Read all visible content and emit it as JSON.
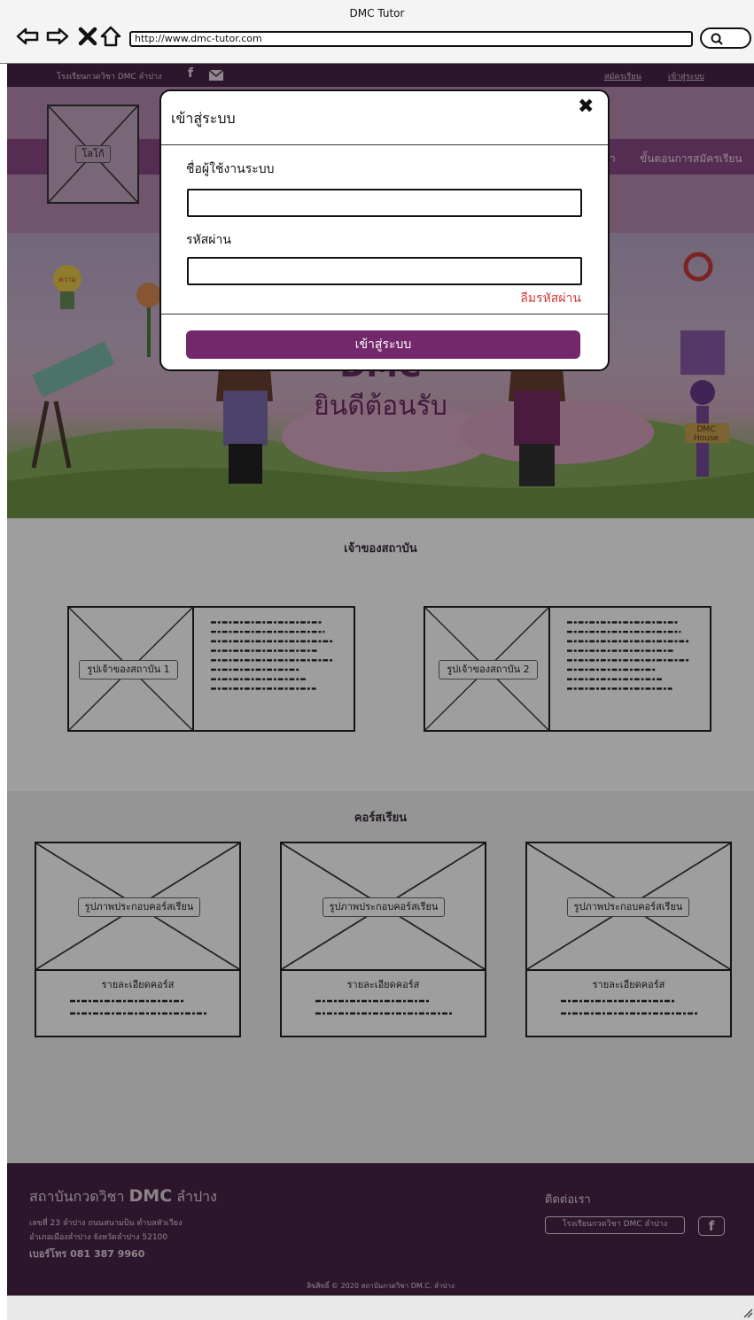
{
  "browser": {
    "window_title": "DMC Tutor",
    "url": "http://www.dmc-tutor.com"
  },
  "topbar": {
    "school_name": "โรงเรียนกวดวิชา DMC ลำปาง",
    "register_link": "สมัครเรียน",
    "login_link": "เข้าสู่ระบบ"
  },
  "header": {
    "logo_label": "โลโก้",
    "menu_partial": "า",
    "menu_register_steps": "ขั้นตอนการสมัครเรียน"
  },
  "banner": {
    "headline": "DMC",
    "welcome": "ยินดีต้อนรับ",
    "sign_text": "DMC House",
    "bulb_text": "ความ"
  },
  "owners": {
    "title": "เจ้าของสถาบัน",
    "items": [
      {
        "image_label": "รูปเจ้าของสถาบัน 1"
      },
      {
        "image_label": "รูปเจ้าของสถาบัน 2"
      }
    ]
  },
  "courses": {
    "title": "คอร์สเรียน",
    "items": [
      {
        "image_label": "รูปภาพประกอบคอร์สเรียน",
        "detail_title": "รายละเอียดคอร์ส"
      },
      {
        "image_label": "รูปภาพประกอบคอร์สเรียน",
        "detail_title": "รายละเอียดคอร์ส"
      },
      {
        "image_label": "รูปภาพประกอบคอร์สเรียน",
        "detail_title": "รายละเอียดคอร์ส"
      }
    ]
  },
  "footer": {
    "institute_prefix": "สถาบันกวดวิชา",
    "institute_brand": "DMC",
    "institute_city": "ลำปาง",
    "address_line1": "เลขที่ 23 ลำปาง ถนนสนามบิน ตำบลหัวเวียง",
    "address_line2": "อำเภอเมืองลำปาง จังหวัดลำปาง 52100",
    "phone_line": "เบอร์โทร 081 387 9960",
    "contact_title": "ติดต่อเรา",
    "facebook_page": "โรงเรียนกวดวิชา DMC ลำปาง",
    "copyright": "ลิขสิทธิ์ © 2020 สถาบันกวดวิชา DM.C. ลำปาง"
  },
  "modal": {
    "title": "เข้าสู่ระบบ",
    "username_label": "ชื่อผู้ใช้งานระบบ",
    "username_value": "",
    "password_label": "รหัสผ่าน",
    "password_value": "",
    "forgot_password": "ลืมรหัสผ่าน",
    "submit_label": "เข้าสู่ระบบ"
  },
  "colors": {
    "brand_purple": "#73286b",
    "topbar_dark": "#4a2347",
    "forgot_red": "#d33a3a"
  }
}
